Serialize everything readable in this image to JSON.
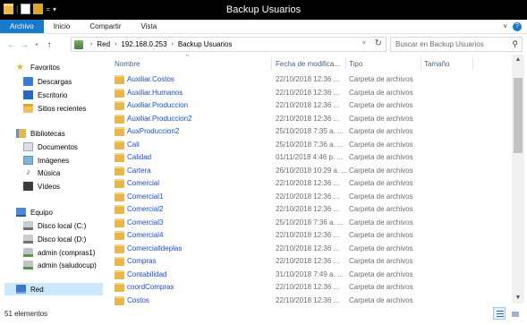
{
  "window": {
    "title": "Backup Usuarios"
  },
  "ribbon": {
    "tabs": [
      "Archivo",
      "Inicio",
      "Compartir",
      "Vista"
    ]
  },
  "address": {
    "crumbs": [
      "Red",
      "192.168.0.253",
      "Backup Usuarios"
    ]
  },
  "search": {
    "placeholder": "Buscar en Backup Usuarios"
  },
  "sidebar": {
    "favorites": {
      "label": "Favoritos",
      "items": [
        "Descargas",
        "Escritorio",
        "Sitios recientes"
      ]
    },
    "libraries": {
      "label": "Bibliotecas",
      "items": [
        "Documentos",
        "Imágenes",
        "Música",
        "Vídeos"
      ]
    },
    "computer": {
      "label": "Equipo",
      "items": [
        "Disco local (C:)",
        "Disco local (D:)",
        "admin (compras1)",
        "admin (saludocup)"
      ]
    },
    "network": {
      "label": "Red"
    }
  },
  "columns": {
    "name": "Nombre",
    "date": "Fecha de modifica...",
    "type": "Tipo",
    "size": "Tamaño"
  },
  "files": [
    {
      "name": "Auxiliar.Costos",
      "date": "22/10/2018 12:36 ...",
      "type": "Carpeta de archivos"
    },
    {
      "name": "Auxiliar.Humanos",
      "date": "22/10/2018 12:36 ...",
      "type": "Carpeta de archivos"
    },
    {
      "name": "Auxiliar.Produccion",
      "date": "22/10/2018 12:36 ...",
      "type": "Carpeta de archivos"
    },
    {
      "name": "Auxiliar.Produccion2",
      "date": "22/10/2018 12:36 ...",
      "type": "Carpeta de archivos"
    },
    {
      "name": "AuxProduccion2",
      "date": "25/10/2018 7:35 a. ...",
      "type": "Carpeta de archivos"
    },
    {
      "name": "Cali",
      "date": "25/10/2018 7:36 a. ...",
      "type": "Carpeta de archivos"
    },
    {
      "name": "Calidad",
      "date": "01/11/2018 4:46 p. ...",
      "type": "Carpeta de archivos"
    },
    {
      "name": "Cartera",
      "date": "26/10/2018 10:29 a. ...",
      "type": "Carpeta de archivos"
    },
    {
      "name": "Comercial",
      "date": "22/10/2018 12:36 ...",
      "type": "Carpeta de archivos"
    },
    {
      "name": "Comercial1",
      "date": "22/10/2018 12:36 ...",
      "type": "Carpeta de archivos"
    },
    {
      "name": "Comercial2",
      "date": "22/10/2018 12:36 ...",
      "type": "Carpeta de archivos"
    },
    {
      "name": "Comercial3",
      "date": "25/10/2018 7:36 a. ...",
      "type": "Carpeta de archivos"
    },
    {
      "name": "Comercial4",
      "date": "22/10/2018 12:36 ...",
      "type": "Carpeta de archivos"
    },
    {
      "name": "Comercialldeplas",
      "date": "22/10/2018 12:36 ...",
      "type": "Carpeta de archivos"
    },
    {
      "name": "Compras",
      "date": "22/10/2018 12:36 ...",
      "type": "Carpeta de archivos"
    },
    {
      "name": "Contabilidad",
      "date": "31/10/2018 7:49 a. ...",
      "type": "Carpeta de archivos"
    },
    {
      "name": "coordCompras",
      "date": "22/10/2018 12:36 ...",
      "type": "Carpeta de archivos"
    },
    {
      "name": "Costos",
      "date": "22/10/2018 12:36 ...",
      "type": "Carpeta de archivos"
    }
  ],
  "status": {
    "count": "51 elementos"
  }
}
